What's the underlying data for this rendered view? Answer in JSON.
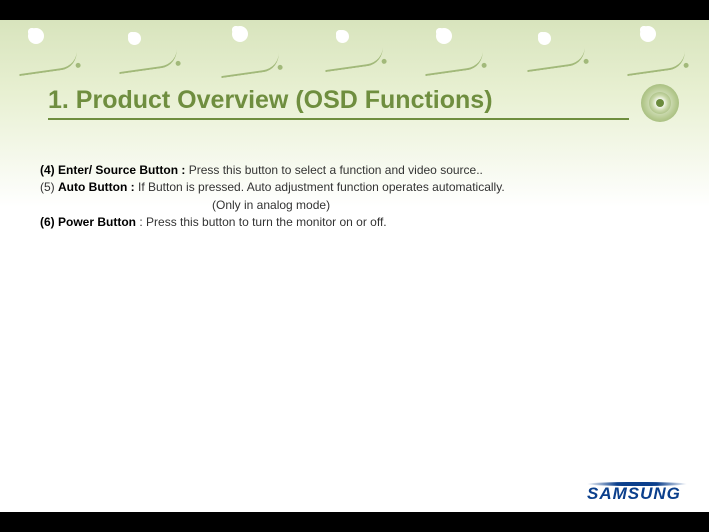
{
  "title": "1. Product Overview (OSD Functions)",
  "items": [
    {
      "num": "(4)",
      "name": "Enter/ Source Button",
      "sep": "  :  ",
      "desc": "Press this button to select a function and video source..",
      "note": ""
    },
    {
      "num": "(5)",
      "name": "Auto Button",
      "sep": "     :  ",
      "desc": "If Button is pressed. Auto adjustment  function operates automatically.",
      "note": "(Only in analog mode)"
    },
    {
      "num": "(6)",
      "name": "Power Button",
      "sep": "            :  ",
      "desc": "Press this button to turn the monitor on or off.",
      "note": ""
    }
  ],
  "brand": "SAMSUNG"
}
